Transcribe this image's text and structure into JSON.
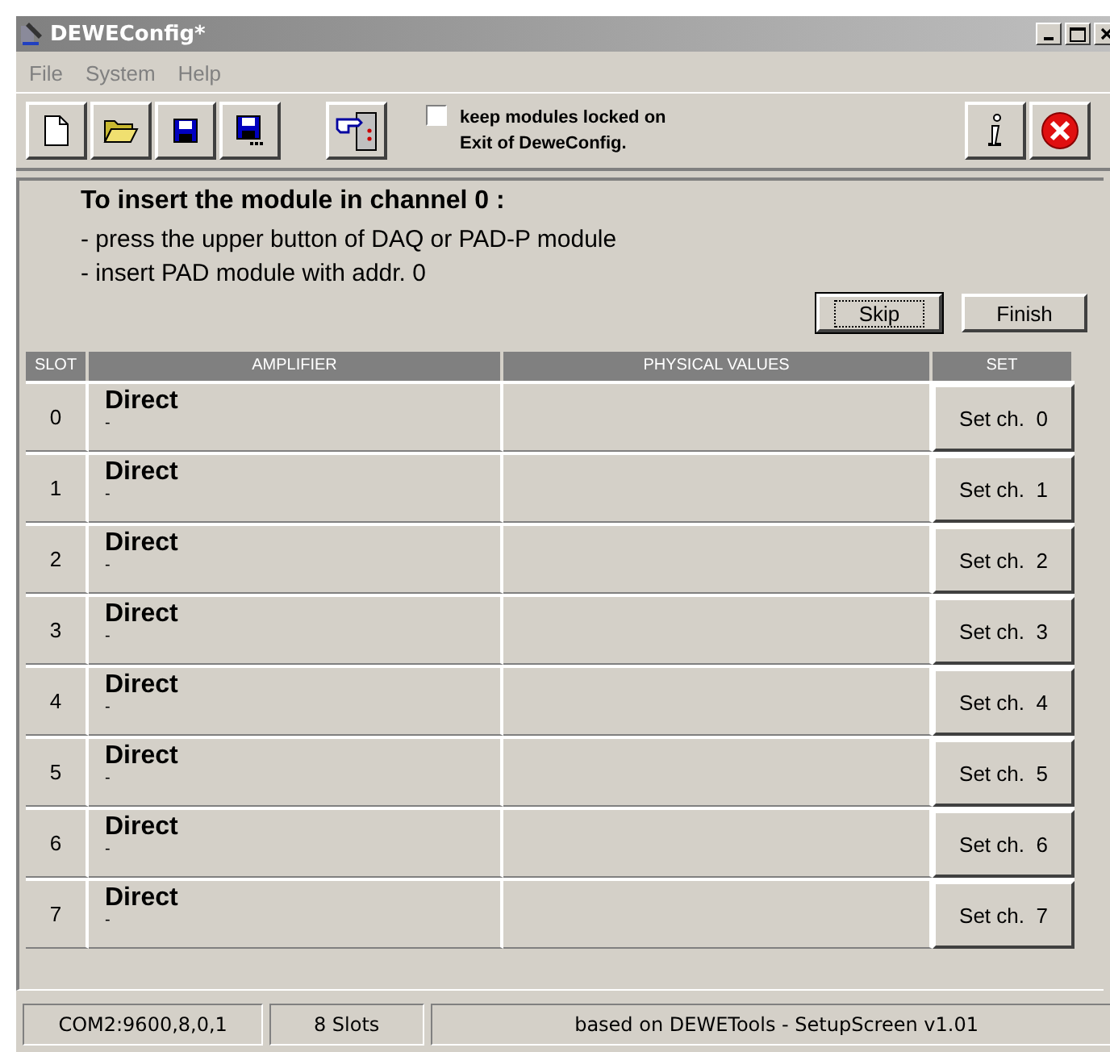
{
  "window": {
    "title": "DEWEConfig*"
  },
  "menu": [
    {
      "label": "File",
      "disabled": true
    },
    {
      "label": "System",
      "disabled": true
    },
    {
      "label": "Help",
      "disabled": true
    }
  ],
  "toolbar": {
    "lock_option": {
      "checked": false,
      "lines": [
        "keep modules locked on",
        "Exit of DeweConfig."
      ]
    }
  },
  "instructions": {
    "heading": "To insert the module in channel 0 :",
    "lines": [
      "- press the upper button of DAQ or PAD-P module",
      "- insert PAD module with addr. 0"
    ]
  },
  "buttons": [
    {
      "label": "Skip",
      "focused": true
    },
    {
      "label": "Finish",
      "focused": false
    }
  ],
  "table": {
    "columns": [
      "SLOT",
      "AMPLIFIER",
      "PHYSICAL VALUES",
      "SET"
    ],
    "rows": [
      {
        "slot": "0",
        "amplifier": "Direct",
        "detail": "-",
        "action": "Set ch.  0"
      },
      {
        "slot": "1",
        "amplifier": "Direct",
        "detail": "-",
        "action": "Set ch.  1"
      },
      {
        "slot": "2",
        "amplifier": "Direct",
        "detail": "-",
        "action": "Set ch.  2"
      },
      {
        "slot": "3",
        "amplifier": "Direct",
        "detail": "-",
        "action": "Set ch.  3"
      },
      {
        "slot": "4",
        "amplifier": "Direct",
        "detail": "-",
        "action": "Set ch.  4"
      },
      {
        "slot": "5",
        "amplifier": "Direct",
        "detail": "-",
        "action": "Set ch.  5"
      },
      {
        "slot": "6",
        "amplifier": "Direct",
        "detail": "-",
        "action": "Set ch.  6"
      },
      {
        "slot": "7",
        "amplifier": "Direct",
        "detail": "-",
        "action": "Set ch.  7"
      }
    ]
  },
  "status_bar": [
    "COM2:9600,8,0,1",
    "8 Slots",
    "based on DEWETools - SetupScreen v1.01"
  ]
}
